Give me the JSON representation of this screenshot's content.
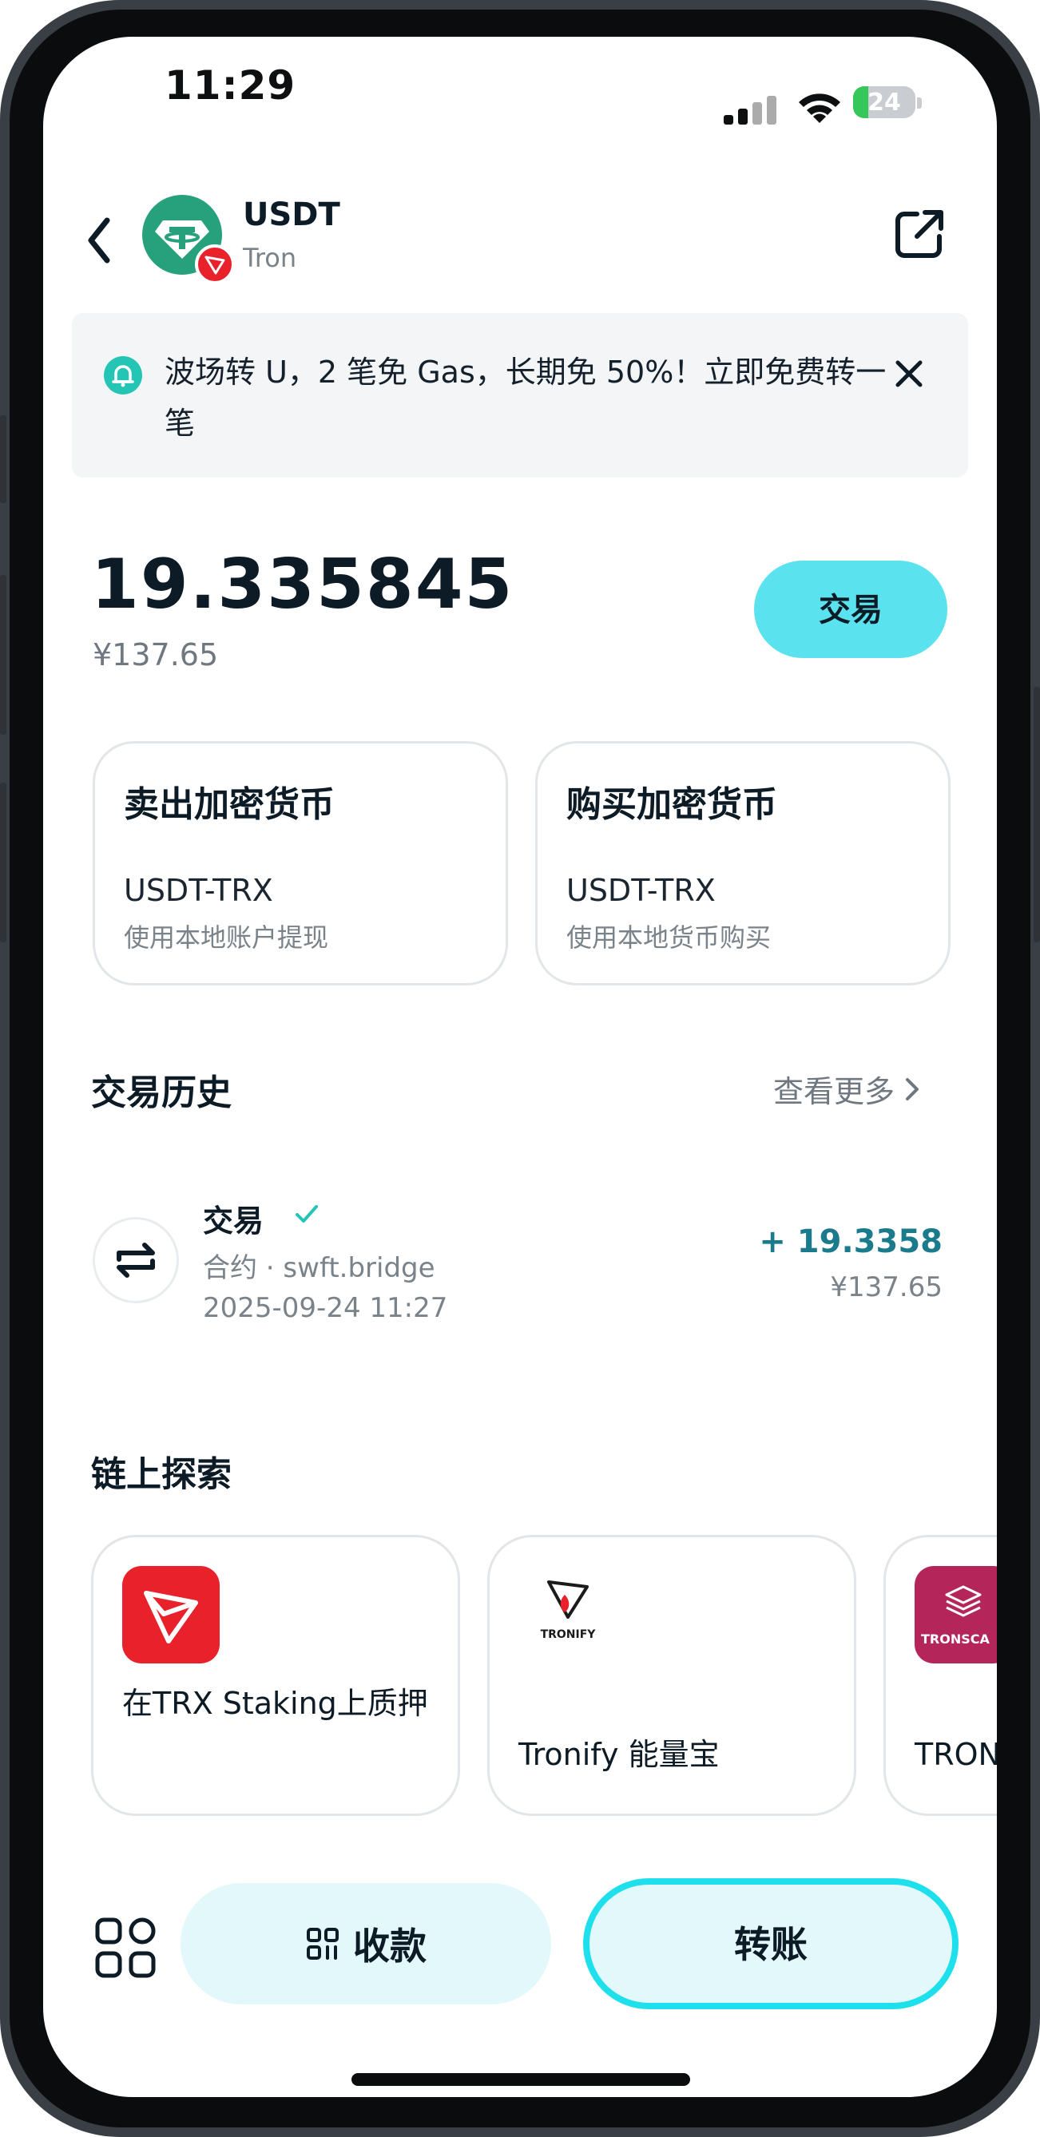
{
  "status_bar": {
    "time": "11:29",
    "battery": "24",
    "battery_level": 0.24
  },
  "header": {
    "token_symbol": "USDT",
    "chain": "Tron"
  },
  "banner": {
    "text": "波场转 U，2 笔免 Gas，长期免 50%！立即免费转一笔"
  },
  "balance": {
    "amount": "19.335845",
    "fiat": "¥137.65",
    "trade_label": "交易"
  },
  "cards": [
    {
      "title": "卖出加密货币",
      "pair": "USDT-TRX",
      "subtitle": "使用本地账户提现"
    },
    {
      "title": "购买加密货币",
      "pair": "USDT-TRX",
      "subtitle": "使用本地货币购买"
    }
  ],
  "history": {
    "title": "交易历史",
    "see_more": "查看更多",
    "items": [
      {
        "title": "交易",
        "meta": "合约 · swft.bridge",
        "date": "2025-09-24 11:27",
        "amount": "+ 19.3358",
        "fiat": "¥137.65"
      }
    ]
  },
  "explore": {
    "title": "链上探索",
    "items": [
      {
        "label": "在TRX Staking上质押",
        "logo_text": ""
      },
      {
        "label": "Tronify 能量宝",
        "logo_text": "TRONIFY"
      },
      {
        "label": "TRON",
        "logo_text": "TRONSCA"
      }
    ]
  },
  "bottom_bar": {
    "receive_label": "收款",
    "transfer_label": "转账"
  },
  "colors": {
    "accent": "#5ae2ef",
    "transfer_border": "#1ee0ec",
    "positive_amount": "#1b7b8c",
    "tether_green": "#26a17b",
    "tron_red": "#e8212a",
    "tronscan_magenta": "#b4265a"
  },
  "icons": {
    "back": "chevron-left-icon",
    "share": "external-link-icon",
    "bell": "bell-icon",
    "close": "close-icon",
    "check": "check-icon",
    "swap": "swap-arrows-icon",
    "more": "chevron-right-icon",
    "apps": "apps-grid-icon",
    "qr": "qr-code-icon"
  }
}
